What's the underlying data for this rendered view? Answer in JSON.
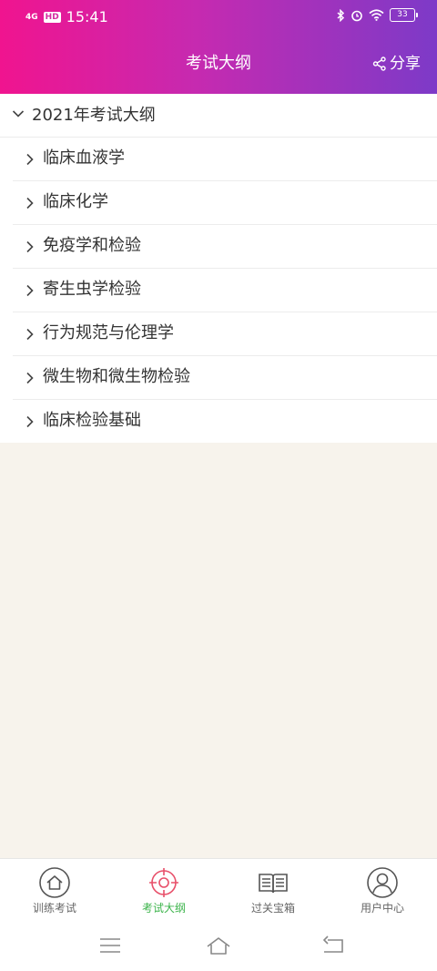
{
  "status_bar": {
    "signal": "4G",
    "hd": "HD",
    "time": "15:41",
    "battery": "33"
  },
  "header": {
    "title": "考试大纲",
    "share_label": "分享"
  },
  "outline": {
    "group_title": "2021年考试大纲",
    "items": [
      {
        "label": "临床血液学"
      },
      {
        "label": "临床化学"
      },
      {
        "label": "免疫学和检验"
      },
      {
        "label": "寄生虫学检验"
      },
      {
        "label": "行为规范与伦理学"
      },
      {
        "label": "微生物和微生物检验"
      },
      {
        "label": "临床检验基础"
      }
    ]
  },
  "tabs": [
    {
      "label": "训练考试",
      "icon": "home-icon",
      "active": false
    },
    {
      "label": "考试大纲",
      "icon": "target-icon",
      "active": true
    },
    {
      "label": "过关宝箱",
      "icon": "book-icon",
      "active": false
    },
    {
      "label": "用户中心",
      "icon": "user-icon",
      "active": false
    }
  ],
  "colors": {
    "header_start": "#f0148f",
    "header_end": "#7d3ac8",
    "active_tab": "#3cb44b",
    "active_icon": "#e8506a"
  }
}
